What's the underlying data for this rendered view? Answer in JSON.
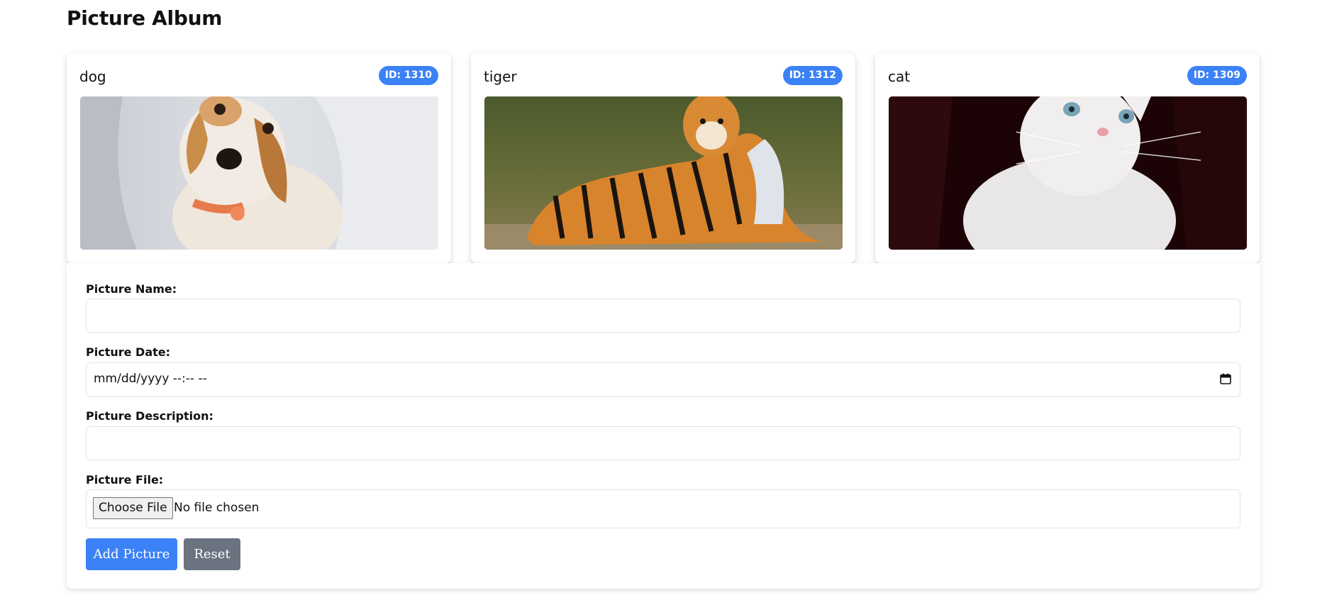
{
  "page": {
    "title": "Picture Album"
  },
  "pictures": [
    {
      "name": "dog",
      "id_label": "ID: 1310",
      "image": "puppy-photo"
    },
    {
      "name": "tiger",
      "id_label": "ID: 1312",
      "image": "tiger-photo"
    },
    {
      "name": "cat",
      "id_label": "ID: 1309",
      "image": "kitten-photo"
    }
  ],
  "form": {
    "name_label": "Picture Name:",
    "name_value": "",
    "date_label": "Picture Date:",
    "date_placeholder": "mm/dd/yyyy --:-- --",
    "description_label": "Picture Description:",
    "description_value": "",
    "file_label": "Picture File:",
    "choose_file_label": "Choose File",
    "no_file_text": "No file chosen",
    "add_button": "Add Picture",
    "reset_button": "Reset"
  },
  "colors": {
    "accent": "#3b82f6",
    "secondary": "#6b7280"
  },
  "icons": {
    "date_picker": "calendar-icon"
  }
}
